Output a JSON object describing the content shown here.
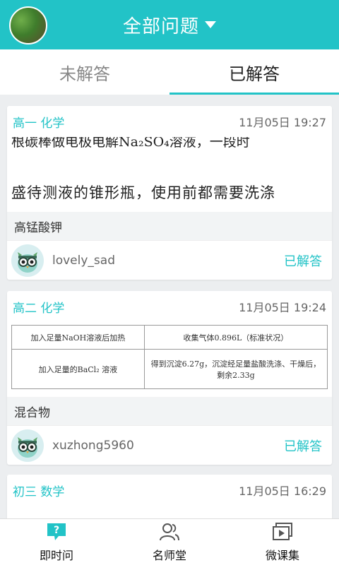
{
  "header": {
    "title": "全部问题"
  },
  "tabs": [
    {
      "label": "未解答",
      "active": false
    },
    {
      "label": "已解答",
      "active": true
    }
  ],
  "questions": [
    {
      "subject": "高一  化学",
      "time": "11月05日 19:27",
      "image_text": [
        "根碳棒做电极电解Na₂SO₄溶液，一段时",
        "盛待测液的锥形瓶，使用前都需要洗涤"
      ],
      "text": "高锰酸钾",
      "user": "lovely_sad",
      "status": "已解答"
    },
    {
      "subject": "高二  化学",
      "time": "11月05日 19:24",
      "image_table": [
        [
          "加入足量NaOH溶液后加热",
          "收集气体0.896L（标准状况）"
        ],
        [
          "加入足量的BaCl₂ 溶液",
          "得到沉淀6.27g，沉淀经足量盐酸洗涤、干燥后，剩余2.33g"
        ]
      ],
      "text": "混合物",
      "user": "xuzhong5960",
      "status": "已解答"
    },
    {
      "subject": "初三  数学",
      "time": "11月05日 16:29"
    }
  ],
  "bottom_nav": [
    {
      "label": "即时问",
      "icon": "question-bubble-icon"
    },
    {
      "label": "名师堂",
      "icon": "teachers-icon"
    },
    {
      "label": "微课集",
      "icon": "video-play-icon"
    }
  ],
  "colors": {
    "accent": "#22c3c7"
  }
}
